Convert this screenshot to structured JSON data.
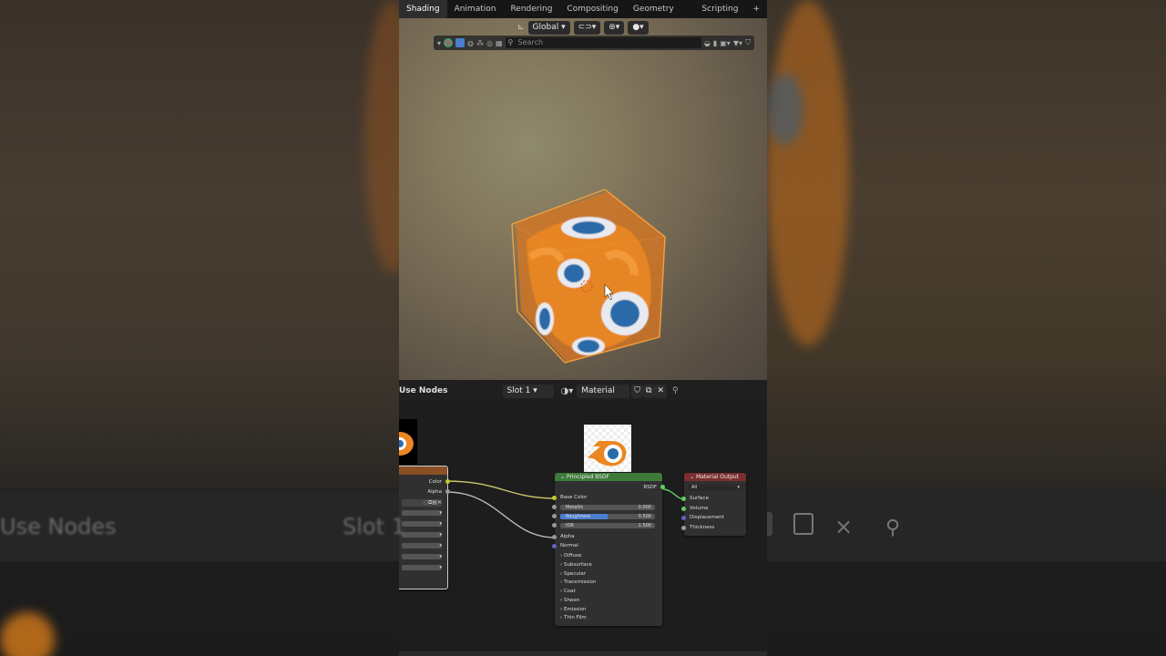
{
  "workspace_tabs": [
    "Shading",
    "Animation",
    "Rendering",
    "Compositing",
    "Geometry Nodes",
    "Scripting",
    "+"
  ],
  "active_tab": "Shading",
  "viewport": {
    "orientation": "Global",
    "search_placeholder": "Search"
  },
  "node_editor": {
    "use_nodes_label": "Use Nodes",
    "slot": "Slot 1",
    "material": "Material"
  },
  "image_node": {
    "outputs": [
      "Color",
      "Alpha"
    ]
  },
  "bsdf_node": {
    "title": "Principled BSDF",
    "output": "BSDF",
    "inputs": [
      "Base Color"
    ],
    "fields": [
      {
        "label": "Metallic",
        "value": "0.000"
      },
      {
        "label": "Roughness",
        "value": "0.500"
      },
      {
        "label": "IOR",
        "value": "1.500"
      }
    ],
    "more_inputs": [
      "Alpha",
      "Normal"
    ],
    "panels": [
      "Diffuse",
      "Subsurface",
      "Specular",
      "Transmission",
      "Coat",
      "Sheen",
      "Emission",
      "Thin Film"
    ]
  },
  "output_node": {
    "title": "Material Output",
    "target": "All",
    "inputs": [
      "Surface",
      "Volume",
      "Displacement",
      "Thickness"
    ]
  },
  "background_text": {
    "left": "Use Nodes",
    "right": "Slot 1"
  },
  "colors": {
    "accent_orange": "#ee8a1f",
    "blender_blue": "#2a6ba8",
    "shader_green": "#3f7a3b",
    "output_red": "#7a2e2e"
  }
}
